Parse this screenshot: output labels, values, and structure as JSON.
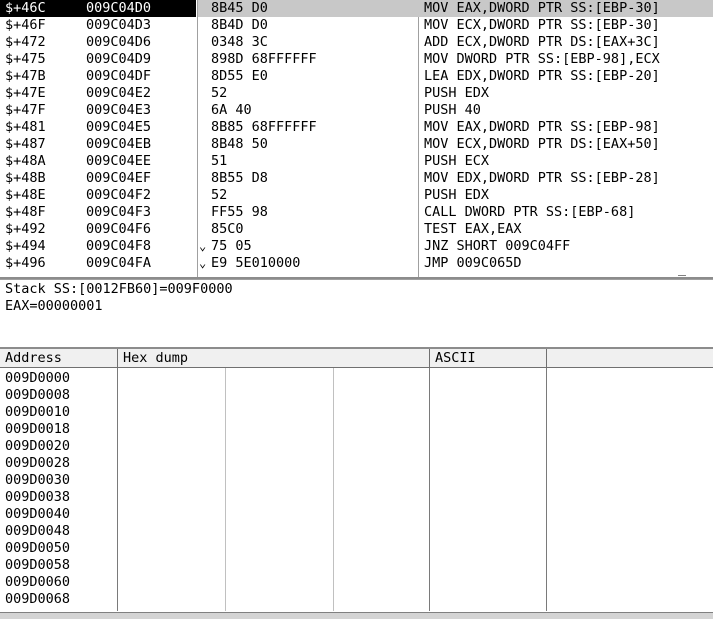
{
  "disasm": {
    "rows": [
      {
        "addr": "$+46C",
        "abs": "009C04D0",
        "hex": "8B45 D0",
        "jmp": "",
        "cmd": "MOV EAX,DWORD PTR SS:[EBP-30]",
        "selected": true
      },
      {
        "addr": "$+46F",
        "abs": "009C04D3",
        "hex": "8B4D D0",
        "jmp": "",
        "cmd": "MOV ECX,DWORD PTR SS:[EBP-30]"
      },
      {
        "addr": "$+472",
        "abs": "009C04D6",
        "hex": "0348 3C",
        "jmp": "",
        "cmd": "ADD ECX,DWORD PTR DS:[EAX+3C]"
      },
      {
        "addr": "$+475",
        "abs": "009C04D9",
        "hex": "898D 68FFFFFF",
        "jmp": "",
        "cmd": "MOV DWORD PTR SS:[EBP-98],ECX"
      },
      {
        "addr": "$+47B",
        "abs": "009C04DF",
        "hex": "8D55 E0",
        "jmp": "",
        "cmd": "LEA EDX,DWORD PTR SS:[EBP-20]"
      },
      {
        "addr": "$+47E",
        "abs": "009C04E2",
        "hex": "52",
        "jmp": "",
        "cmd": "PUSH EDX"
      },
      {
        "addr": "$+47F",
        "abs": "009C04E3",
        "hex": "6A 40",
        "jmp": "",
        "cmd": "PUSH 40"
      },
      {
        "addr": "$+481",
        "abs": "009C04E5",
        "hex": "8B85 68FFFFFF",
        "jmp": "",
        "cmd": "MOV EAX,DWORD PTR SS:[EBP-98]"
      },
      {
        "addr": "$+487",
        "abs": "009C04EB",
        "hex": "8B48 50",
        "jmp": "",
        "cmd": "MOV ECX,DWORD PTR DS:[EAX+50]"
      },
      {
        "addr": "$+48A",
        "abs": "009C04EE",
        "hex": "51",
        "jmp": "",
        "cmd": "PUSH ECX"
      },
      {
        "addr": "$+48B",
        "abs": "009C04EF",
        "hex": "8B55 D8",
        "jmp": "",
        "cmd": "MOV EDX,DWORD PTR SS:[EBP-28]"
      },
      {
        "addr": "$+48E",
        "abs": "009C04F2",
        "hex": "52",
        "jmp": "",
        "cmd": "PUSH EDX"
      },
      {
        "addr": "$+48F",
        "abs": "009C04F3",
        "hex": "FF55 98",
        "jmp": "",
        "cmd": "CALL DWORD PTR SS:[EBP-68]"
      },
      {
        "addr": "$+492",
        "abs": "009C04F6",
        "hex": "85C0",
        "jmp": "",
        "cmd": "TEST EAX,EAX"
      },
      {
        "addr": "$+494",
        "abs": "009C04F8",
        "hex": "75 05",
        "jmp": "⌄",
        "cmd": "JNZ SHORT 009C04FF"
      },
      {
        "addr": "$+496",
        "abs": "009C04FA",
        "hex": "E9 5E010000",
        "jmp": "⌄",
        "cmd": "JMP 009C065D"
      }
    ]
  },
  "info": {
    "line1": "Stack SS:[0012FB60]=009F0000",
    "line2": "EAX=00000001"
  },
  "dump": {
    "headers": {
      "address": "Address",
      "hex": "Hex dump",
      "ascii": "ASCII"
    },
    "addresses": [
      "009D0000",
      "009D0008",
      "009D0010",
      "009D0018",
      "009D0020",
      "009D0028",
      "009D0030",
      "009D0038",
      "009D0040",
      "009D0048",
      "009D0050",
      "009D0058",
      "009D0060",
      "009D0068"
    ]
  }
}
